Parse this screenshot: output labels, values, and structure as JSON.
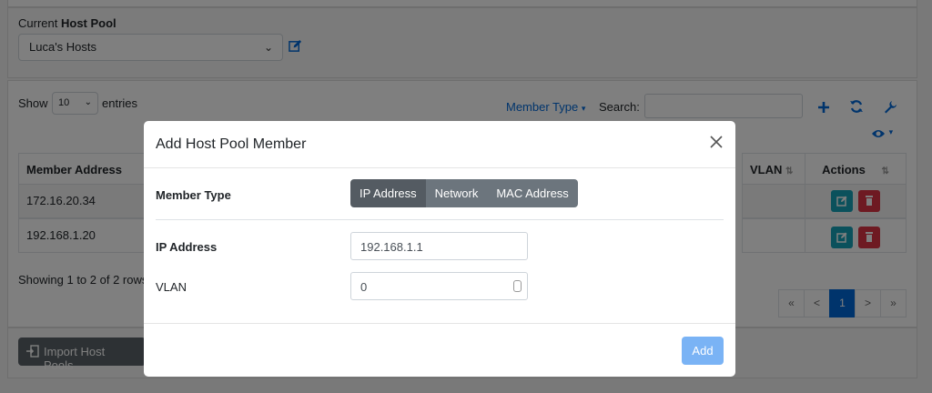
{
  "pool": {
    "label_prefix": "Current",
    "label_bold": "Host Pool",
    "selected": "Luca's Hosts"
  },
  "table_controls": {
    "show": "Show",
    "entries_value": "10",
    "entries": "entries",
    "member_type": "Member Type",
    "search_label": "Search:"
  },
  "table": {
    "headers": [
      "Member Address",
      "VLAN",
      "Actions"
    ],
    "rows": [
      {
        "address": "172.16.20.34"
      },
      {
        "address": "192.168.1.20"
      }
    ],
    "showing": "Showing 1 to 2 of 2 rows"
  },
  "pagination": [
    "«",
    "<",
    "1",
    ">",
    "»"
  ],
  "import_button": "Import Host Pools",
  "modal": {
    "title": "Add Host Pool Member",
    "member_type_label": "Member Type",
    "types": [
      "IP Address",
      "Network",
      "MAC Address"
    ],
    "ip_label": "IP Address",
    "ip_value": "192.168.1.1",
    "vlan_label": "VLAN",
    "vlan_value": "0",
    "add_button": "Add"
  },
  "colors": {
    "primary": "#0069d9",
    "info": "#17a2b8",
    "danger": "#dc3545",
    "secondary": "#6c757d"
  }
}
